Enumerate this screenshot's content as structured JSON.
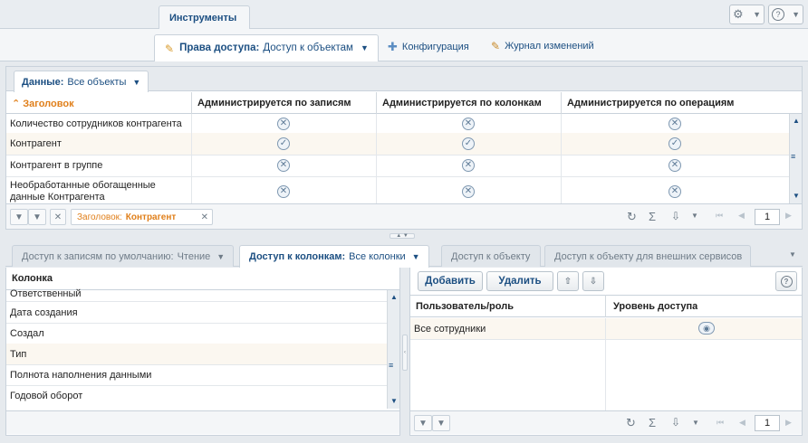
{
  "top": {
    "main_tab": "Инструменты",
    "settings_icon": "gear-icon",
    "help_icon": "question-icon"
  },
  "subtabs": {
    "access_label": "Права доступа:",
    "access_value": "Доступ к объектам",
    "config": "Конфигурация",
    "changelog": "Журнал изменений"
  },
  "data_panel": {
    "filter_label": "Данные:",
    "filter_value": "Все объекты",
    "columns": [
      "Заголовок",
      "Администрируется по записям",
      "Администрируется по колонкам",
      "Администрируется по операциям"
    ],
    "rows": [
      {
        "title": "Количество сотрудников контрагента",
        "records": "x",
        "columns": "x",
        "operations": "x"
      },
      {
        "title": "Контрагент",
        "records": "check",
        "columns": "check",
        "operations": "check"
      },
      {
        "title": "Контрагент в группе",
        "records": "x",
        "columns": "x",
        "operations": "x"
      },
      {
        "title": "Необработанные обогащенные данные Контрагента",
        "records": "x",
        "columns": "x",
        "operations": "x"
      }
    ],
    "filter_tag_label": "Заголовок:",
    "filter_tag_value": "Контрагент",
    "page": "1"
  },
  "bottom_tabs": {
    "default_access_label": "Доступ к записям по умолчанию:",
    "default_access_value": "Чтение",
    "column_access_label": "Доступ к колонкам:",
    "column_access_value": "Все колонки",
    "object_access": "Доступ к объекту",
    "external_access": "Доступ к объекту для внешних сервисов"
  },
  "columns_list": {
    "header": "Колонка",
    "items": [
      "Ответственный",
      "Дата создания",
      "Создал",
      "Тип",
      "Полнота наполнения данными",
      "Годовой оборот"
    ]
  },
  "rights": {
    "add_button": "Добавить",
    "delete_button": "Удалить",
    "col_user": "Пользователь/роль",
    "col_level": "Уровень доступа",
    "rows": [
      {
        "user": "Все сотрудники",
        "level_icon": "eye-icon"
      }
    ],
    "page": "1"
  }
}
